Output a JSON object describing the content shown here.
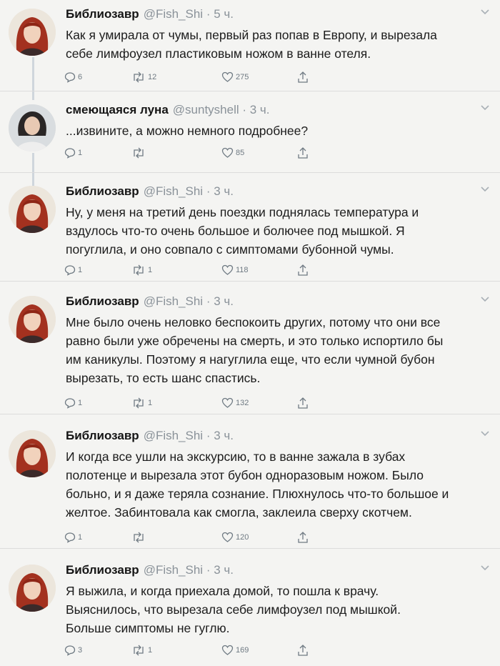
{
  "tweets": [
    {
      "name": "Библиозавр",
      "handle": "@Fish_Shi",
      "time": "· 5 ч.",
      "avatar": "redhead-avatar",
      "lines": [
        "Как я умирала от чумы, первый раз попав в Европу, и вырезала",
        "себе лимфоузел пластиковым ножом в ванне отеля."
      ],
      "replies": "6",
      "retweets": "12",
      "likes": "275"
    },
    {
      "name": "смеющаяся луна",
      "handle": "@suntyshell",
      "time": "· 3 ч.",
      "avatar": "dark-hair-avatar",
      "lines": [
        "...извините, а можно немного подробнее?"
      ],
      "replies": "1",
      "retweets": "",
      "likes": "85"
    },
    {
      "name": "Библиозавр",
      "handle": "@Fish_Shi",
      "time": "· 3 ч.",
      "avatar": "redhead-avatar",
      "lines": [
        "Ну, у меня на третий день поездки поднялась температура и",
        "вздулось что-то очень большое и болючее под мышкой. Я",
        "погуглила, и оно совпало с симптомами бубонной чумы."
      ],
      "replies": "1",
      "retweets": "1",
      "likes": "118"
    },
    {
      "name": "Библиозавр",
      "handle": "@Fish_Shi",
      "time": "· 3 ч.",
      "avatar": "redhead-avatar",
      "lines": [
        "Мне было очень неловко беспокоить других, потому что они все",
        "равно были уже обречены на смерть, и это только испортило бы",
        "им каникулы. Поэтому я нагуглила еще, что если чумной бубон",
        "вырезать, то есть шанс спастись."
      ],
      "replies": "1",
      "retweets": "1",
      "likes": "132"
    },
    {
      "name": "Библиозавр",
      "handle": "@Fish_Shi",
      "time": "· 3 ч.",
      "avatar": "redhead-avatar",
      "lines": [
        "И когда все ушли на экскурсию, то в ванне зажала в зубах",
        "полотенце и вырезала этот бубон одноразовым ножом. Было",
        "больно, и я даже теряла сознание. Плюхнулось что-то большое и",
        "желтое. Забинтовала как смогла, заклеила сверху скотчем."
      ],
      "replies": "1",
      "retweets": "",
      "likes": "120"
    },
    {
      "name": "Библиозавр",
      "handle": "@Fish_Shi",
      "time": "· 3 ч.",
      "avatar": "redhead-avatar",
      "lines": [
        "Я выжила, и когда приехала домой, то пошла к врачу.",
        "Выяснилось, что вырезала себе лимфоузел под мышкой.",
        "Больше симптомы не гуглю."
      ],
      "replies": "3",
      "retweets": "1",
      "likes": "169"
    }
  ],
  "colors": {
    "thread": "#cfd6dc",
    "icon": "#6f7a83",
    "handle": "#8a9299"
  }
}
